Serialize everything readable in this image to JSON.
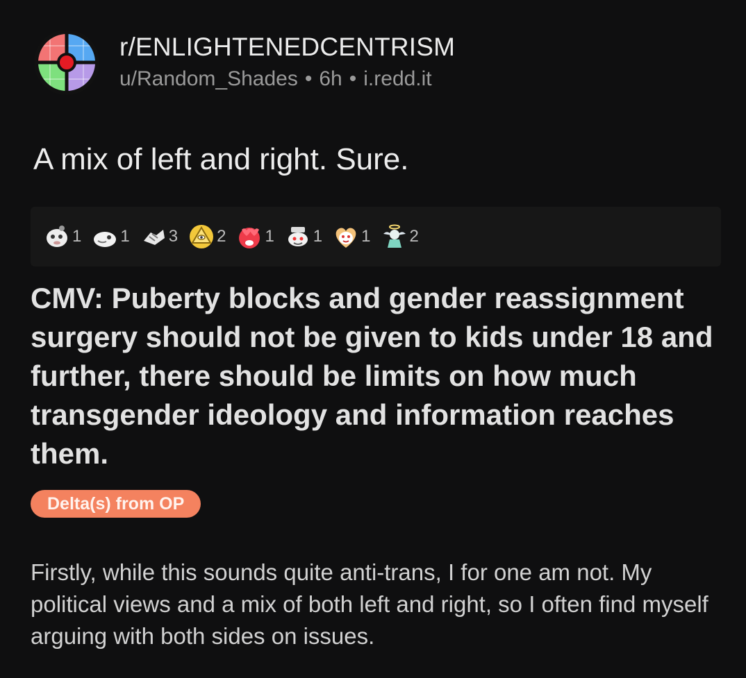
{
  "header": {
    "subreddit": "r/ENLIGHTENEDCENTRISM",
    "username": "u/Random_Shades",
    "separator": "•",
    "time": "6h",
    "domain": "i.redd.it",
    "avatar_icon": "political-compass-icon",
    "avatar_colors": {
      "top_left": "#f27474",
      "top_right": "#56a8f2",
      "bottom_left": "#7ee07e",
      "bottom_right": "#b79ae8",
      "center": "#e51b24"
    }
  },
  "post": {
    "title": "A mix of left and right. Sure."
  },
  "awards": [
    {
      "icon": "ghost-award-icon",
      "count": "1"
    },
    {
      "icon": "blob-award-icon",
      "count": "1"
    },
    {
      "icon": "handshake-award-icon",
      "count": "3"
    },
    {
      "icon": "illuminati-award-icon",
      "count": "2"
    },
    {
      "icon": "heart-eyes-award-icon",
      "count": "1"
    },
    {
      "icon": "snoo-award-icon",
      "count": "1"
    },
    {
      "icon": "heart-face-award-icon",
      "count": "1"
    },
    {
      "icon": "angel-award-icon",
      "count": "2"
    }
  ],
  "screenshot": {
    "title": "CMV: Puberty blocks and gender reassignment surgery should not be given to kids under 18 and further, there should be limits on how much transgender ideology and information reaches them.",
    "flair": "Delta(s) from OP",
    "flair_color": "#f4825f",
    "body": "Firstly, while this sounds quite anti-trans, I for one am not. My political views and a mix of both left and right, so I often find myself arguing with both sides on issues."
  }
}
